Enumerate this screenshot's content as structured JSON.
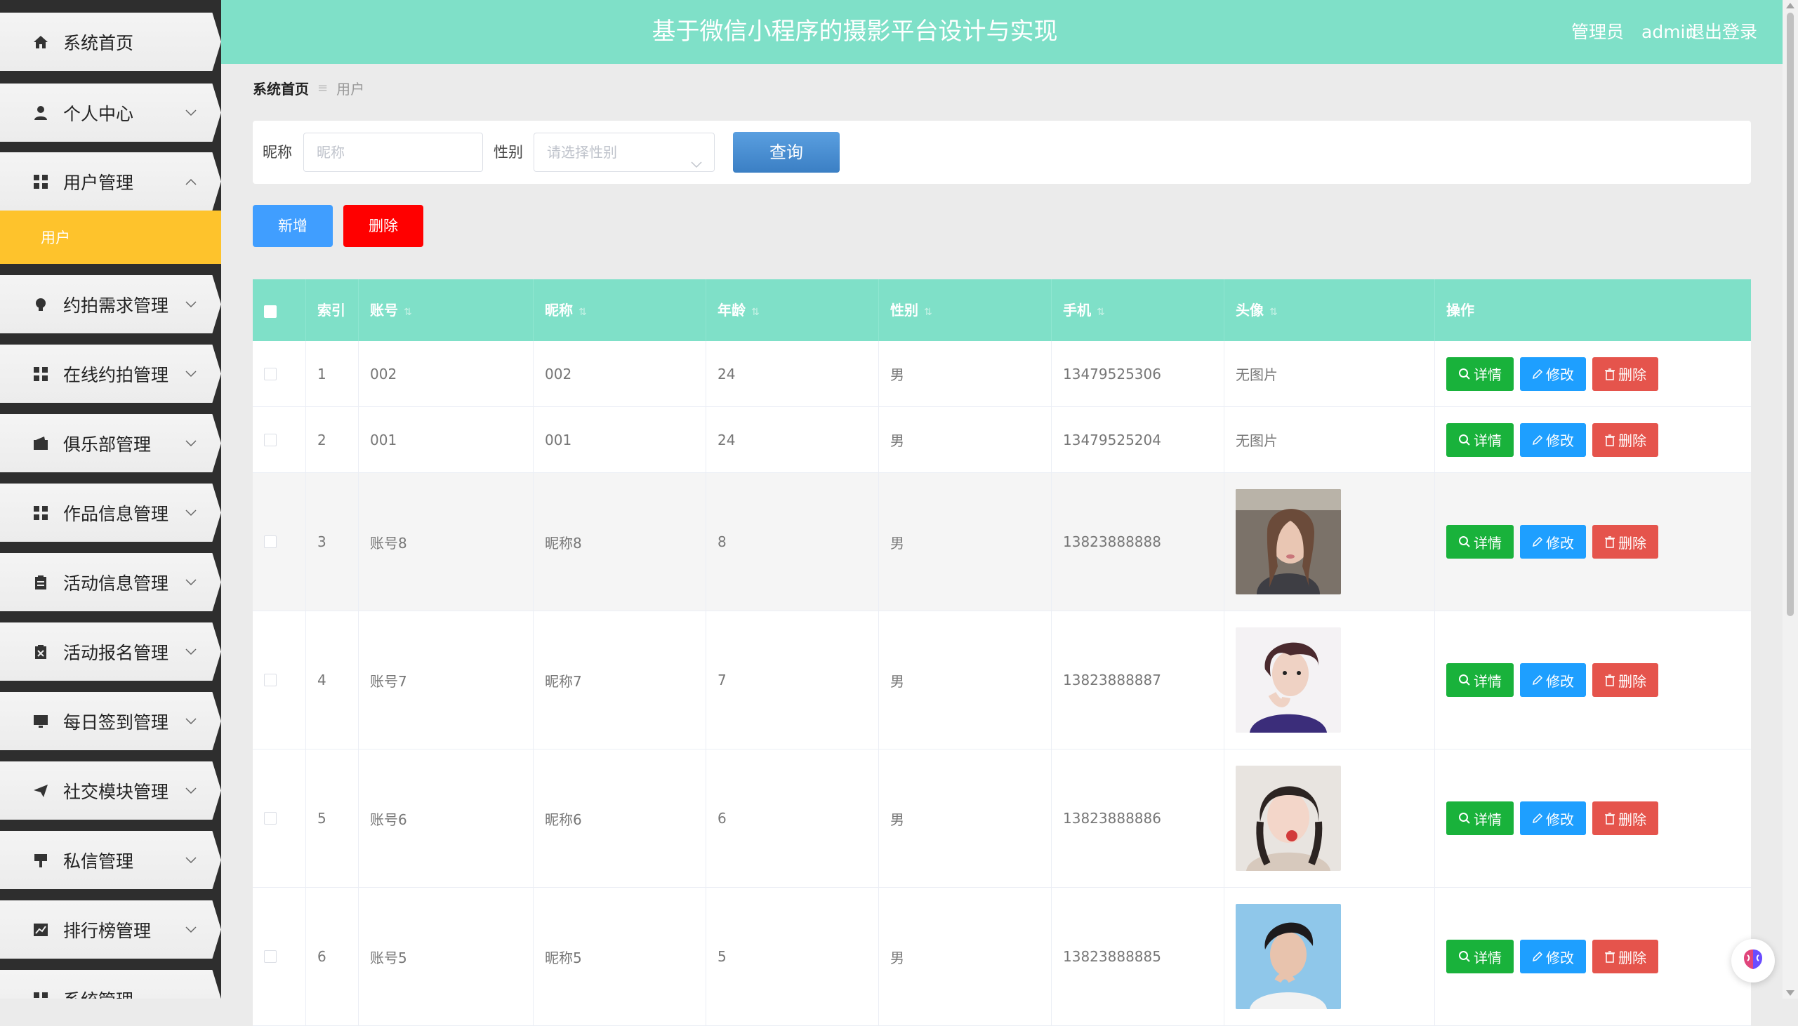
{
  "header": {
    "title": "基于微信小程序的摄影平台设计与实现",
    "user_role": "管理员",
    "user_name": "admin",
    "logout": "退出登录"
  },
  "sidebar": {
    "items": [
      {
        "label": "系统首页",
        "icon": "home-icon"
      },
      {
        "label": "个人中心",
        "icon": "user-icon"
      },
      {
        "label": "用户管理",
        "icon": "grid-icon",
        "expanded": true
      },
      {
        "label": "约拍需求管理",
        "icon": "bulb-icon"
      },
      {
        "label": "在线约拍管理",
        "icon": "grid-icon"
      },
      {
        "label": "俱乐部管理",
        "icon": "wallet-icon"
      },
      {
        "label": "作品信息管理",
        "icon": "grid-icon"
      },
      {
        "label": "活动信息管理",
        "icon": "clipboard-icon"
      },
      {
        "label": "活动报名管理",
        "icon": "clipboard-x-icon"
      },
      {
        "label": "每日签到管理",
        "icon": "monitor-icon"
      },
      {
        "label": "社交模块管理",
        "icon": "send-icon"
      },
      {
        "label": "私信管理",
        "icon": "sign-icon"
      },
      {
        "label": "排行榜管理",
        "icon": "chart-icon"
      },
      {
        "label": "系统管理",
        "icon": "grid-icon"
      }
    ],
    "submenu": {
      "label": "用户"
    }
  },
  "breadcrumb": {
    "home": "系统首页",
    "separator": "≡",
    "current": "用户"
  },
  "search": {
    "nickname_label": "昵称",
    "nickname_placeholder": "昵称",
    "gender_label": "性别",
    "gender_placeholder": "请选择性别",
    "query_button": "查询"
  },
  "actions": {
    "add": "新增",
    "delete": "删除"
  },
  "table": {
    "columns": [
      "索引",
      "账号",
      "昵称",
      "年龄",
      "性别",
      "手机",
      "头像",
      "操作"
    ],
    "rows": [
      {
        "index": "1",
        "account": "002",
        "nickname": "002",
        "age": "24",
        "gender": "男",
        "phone": "13479525306",
        "avatar": "无图片"
      },
      {
        "index": "2",
        "account": "001",
        "nickname": "001",
        "age": "24",
        "gender": "男",
        "phone": "13479525204",
        "avatar": "无图片"
      },
      {
        "index": "3",
        "account": "账号8",
        "nickname": "昵称8",
        "age": "8",
        "gender": "男",
        "phone": "13823888888",
        "avatar": ""
      },
      {
        "index": "4",
        "account": "账号7",
        "nickname": "昵称7",
        "age": "7",
        "gender": "男",
        "phone": "13823888887",
        "avatar": ""
      },
      {
        "index": "5",
        "account": "账号6",
        "nickname": "昵称6",
        "age": "6",
        "gender": "男",
        "phone": "13823888886",
        "avatar": ""
      },
      {
        "index": "6",
        "account": "账号5",
        "nickname": "昵称5",
        "age": "5",
        "gender": "男",
        "phone": "13823888885",
        "avatar": ""
      }
    ],
    "ops": {
      "detail": "详情",
      "edit": "修改",
      "delete": "删除"
    }
  },
  "colors": {
    "header": "#7fe0c8",
    "sidebar_active": "#fec32c",
    "primary": "#409eff",
    "danger": "#ff0000",
    "success": "#19b23b"
  }
}
